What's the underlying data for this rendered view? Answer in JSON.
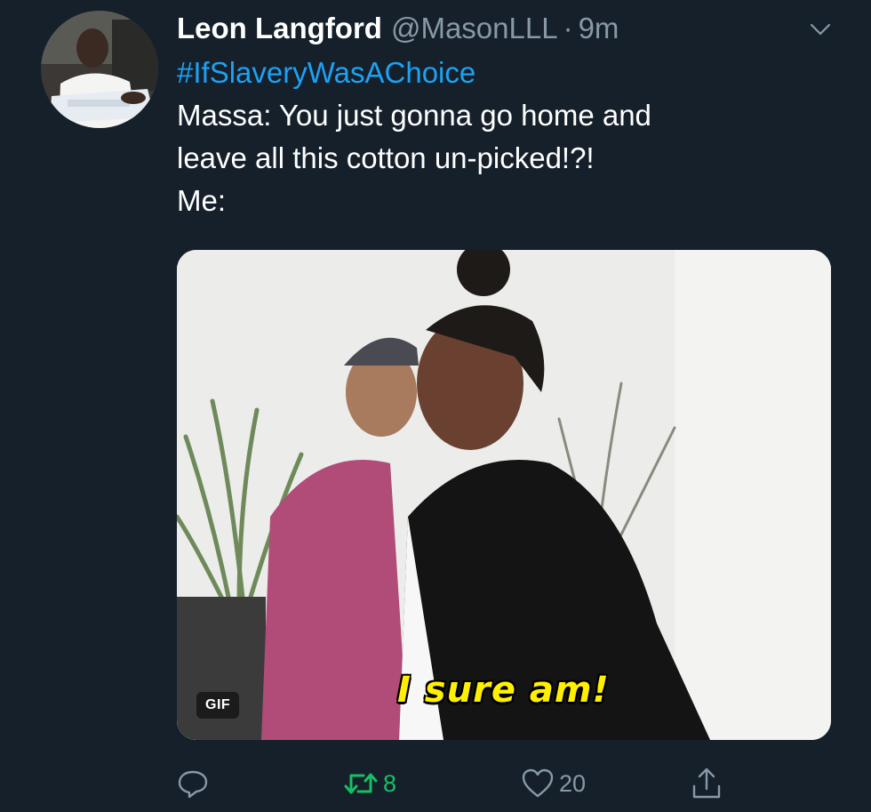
{
  "tweet": {
    "author_name": "Leon Langford",
    "handle": "@MasonLLL",
    "separator": "·",
    "time": "9m",
    "hashtag": "#IfSlaveryWasAChoice",
    "lines": [
      "Massa: You just gonna go home and",
      "leave all this cotton un-picked!?!",
      "Me:"
    ]
  },
  "media": {
    "badge": "GIF",
    "caption": "I sure am!"
  },
  "actions": {
    "reply_icon": "reply-icon",
    "retweet_icon": "retweet-icon",
    "retweet_count": "8",
    "like_icon": "heart-icon",
    "like_count": "20",
    "share_icon": "share-icon"
  },
  "colors": {
    "background": "#15202b",
    "text": "#ffffff",
    "muted": "#8899a6",
    "link": "#1da1f2",
    "retweeted": "#17bf63",
    "caption": "#fff000"
  }
}
